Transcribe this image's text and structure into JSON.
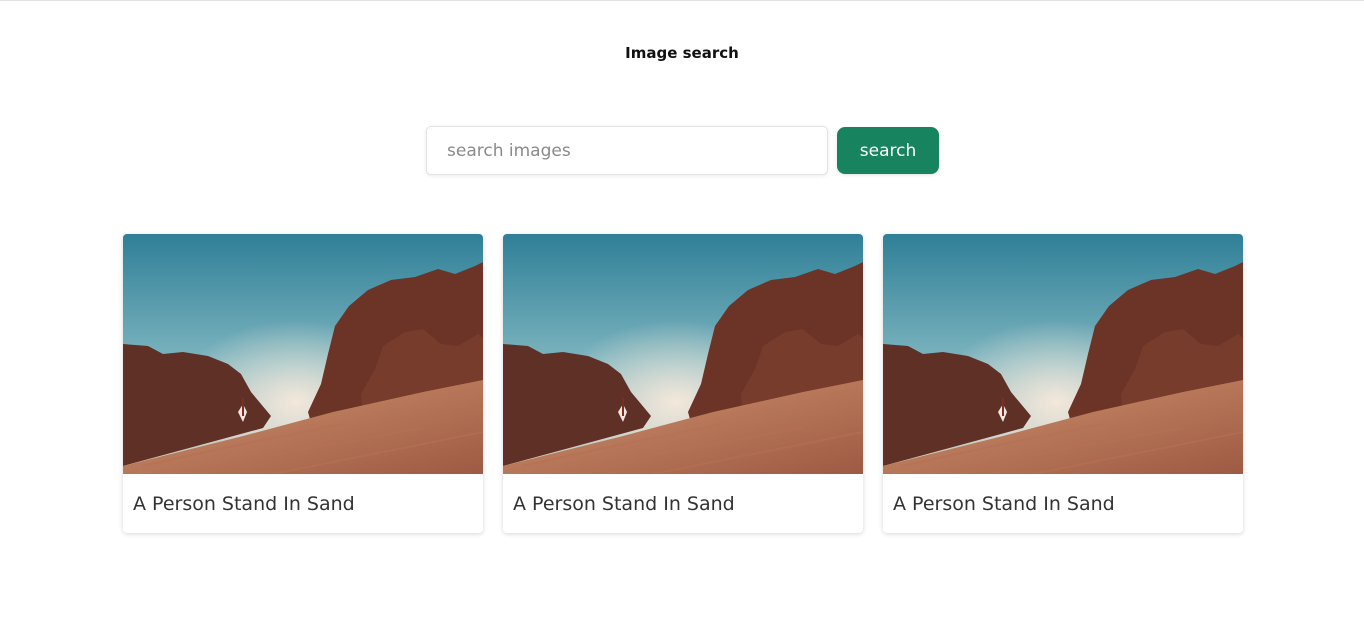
{
  "header": {
    "title": "Image search"
  },
  "search": {
    "placeholder": "search images",
    "value": "",
    "button_label": "search"
  },
  "colors": {
    "accent": "#17845f",
    "sky_top": "#2f7f97",
    "sand": "#b77252",
    "rock": "#6b3426"
  },
  "results": [
    {
      "caption": "A Person Stand In Sand",
      "image": "desert-person-photo"
    },
    {
      "caption": "A Person Stand In Sand",
      "image": "desert-person-photo"
    },
    {
      "caption": "A Person Stand In Sand",
      "image": "desert-person-photo"
    }
  ]
}
